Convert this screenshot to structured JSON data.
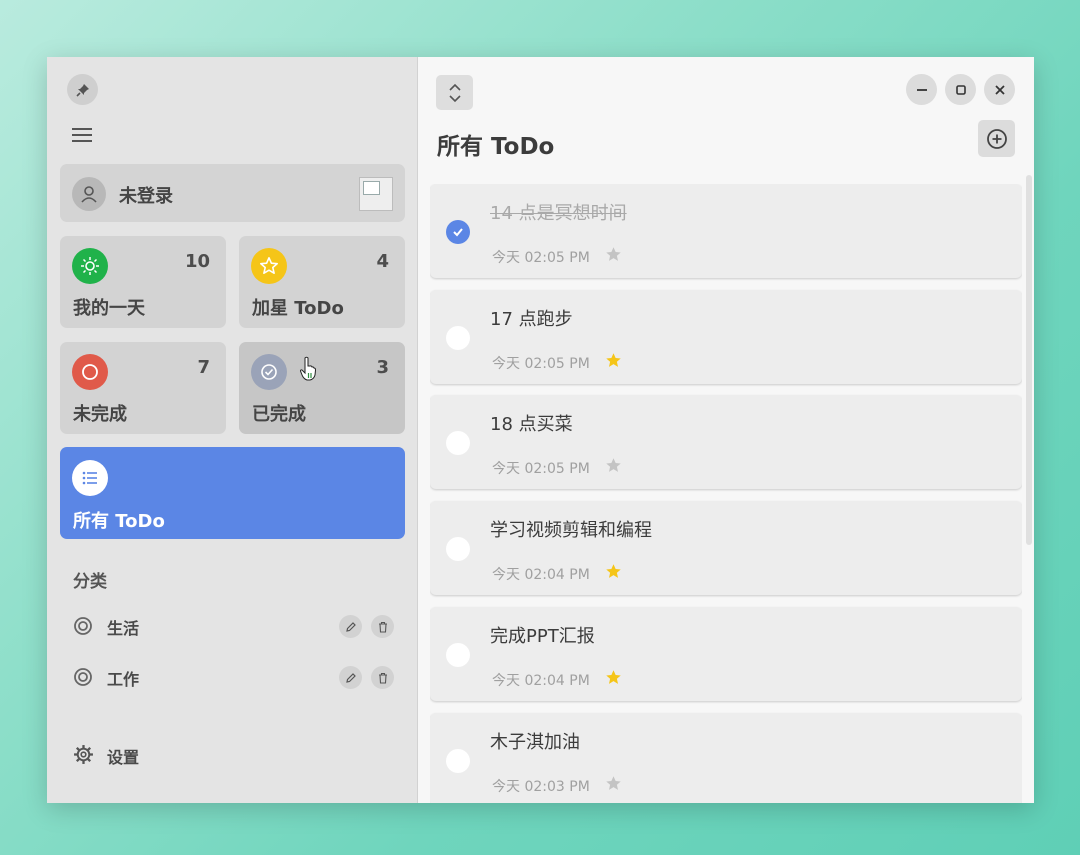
{
  "sidebar": {
    "user": {
      "name": "未登录"
    },
    "cards": [
      {
        "label": "我的一天",
        "count": "10",
        "icon": "sun-icon",
        "color": "#20b24a"
      },
      {
        "label": "加星 ToDo",
        "count": "4",
        "icon": "star-icon",
        "color": "#f5c518"
      },
      {
        "label": "未完成",
        "count": "7",
        "icon": "circle-icon",
        "color": "#e05a4a"
      },
      {
        "label": "已完成",
        "count": "3",
        "icon": "check-circle-icon",
        "color": "#9aa3b8"
      }
    ],
    "all": {
      "label": "所有 ToDo",
      "icon": "list-icon",
      "color": "#5b86e5"
    },
    "categories_title": "分类",
    "categories": [
      {
        "name": "生活"
      },
      {
        "name": "工作"
      }
    ],
    "settings_label": "设置"
  },
  "main": {
    "title": "所有 ToDo",
    "items": [
      {
        "title": "14 点是冥想时间",
        "time": "今天 02:05 PM",
        "done": true,
        "starred": false
      },
      {
        "title": "17 点跑步",
        "time": "今天 02:05 PM",
        "done": false,
        "starred": true
      },
      {
        "title": "18 点买菜",
        "time": "今天 02:05 PM",
        "done": false,
        "starred": false
      },
      {
        "title": "学习视频剪辑和编程",
        "time": "今天 02:04 PM",
        "done": false,
        "starred": true
      },
      {
        "title": "完成PPT汇报",
        "time": "今天 02:04 PM",
        "done": false,
        "starred": true
      },
      {
        "title": "木子淇加油",
        "time": "今天 02:03 PM",
        "done": false,
        "starred": false
      }
    ]
  },
  "colors": {
    "accent": "#5b86e5",
    "star_on": "#f5c518",
    "star_off": "#c4c4c4"
  }
}
